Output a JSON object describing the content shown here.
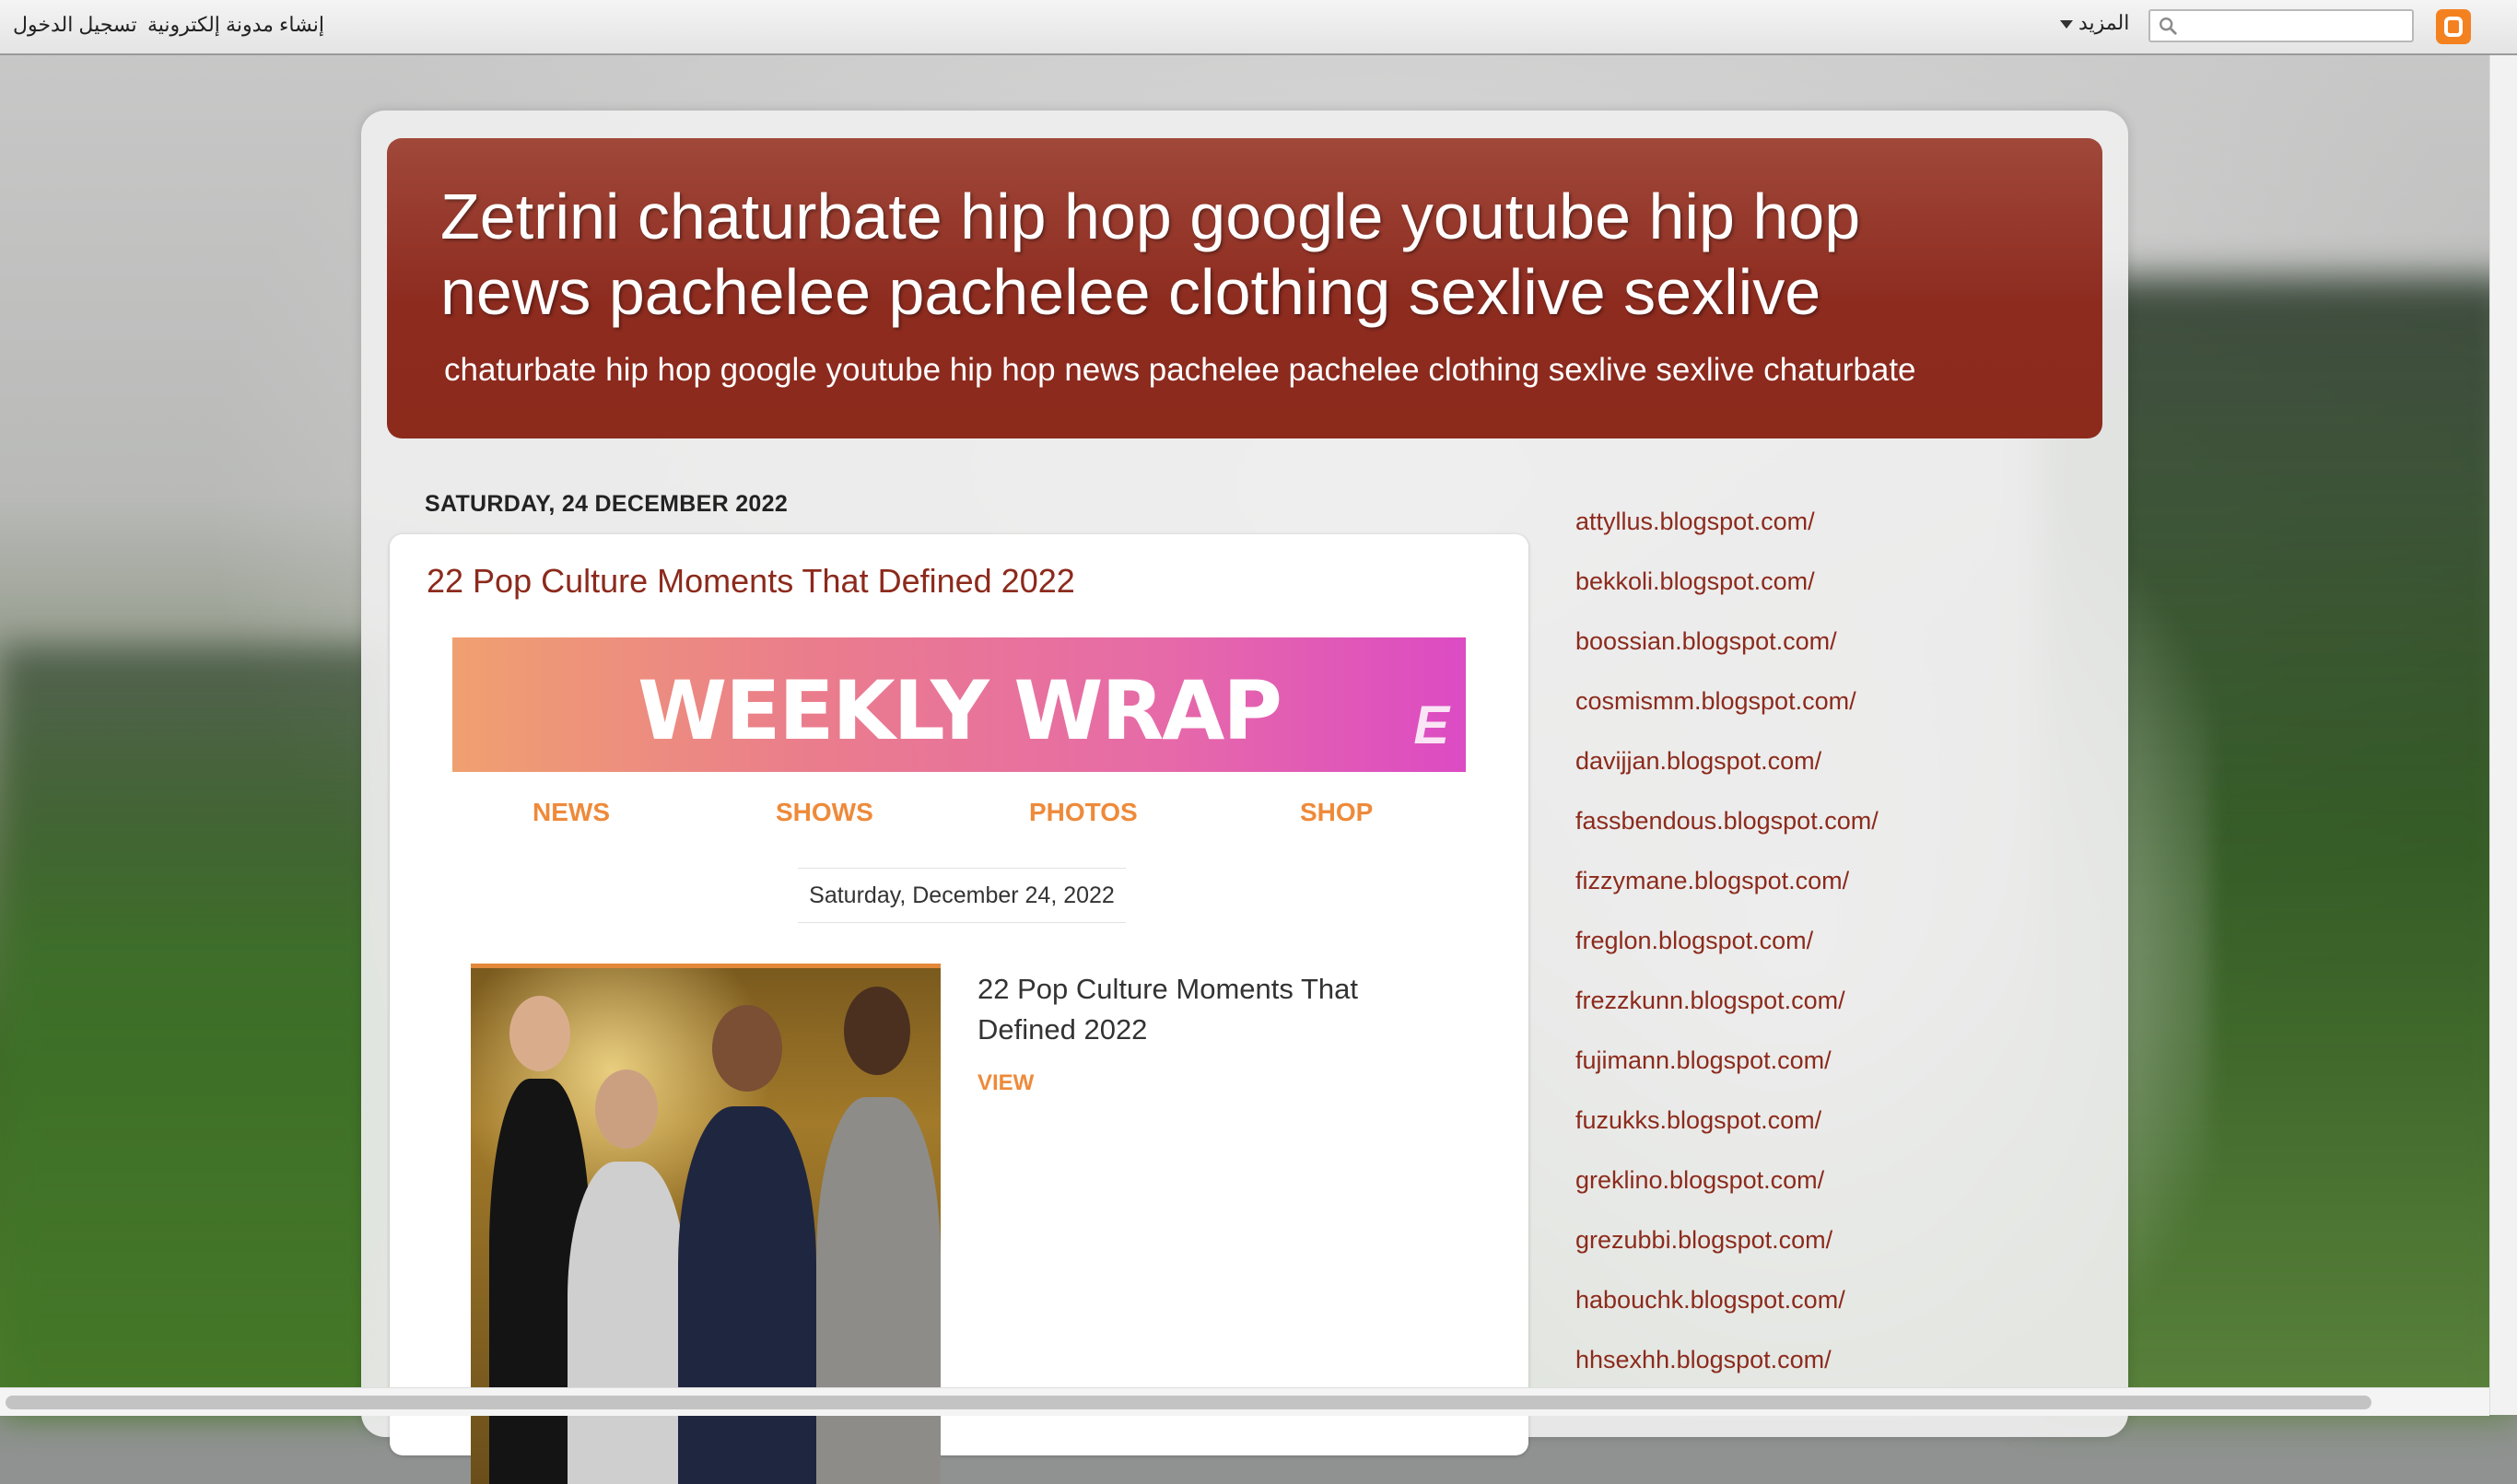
{
  "navbar": {
    "login": "تسجيل الدخول",
    "create_blog": "إنشاء مدونة إلكترونية",
    "more": "المزيد",
    "search_placeholder": ""
  },
  "blog": {
    "title": "Zetrini chaturbate hip hop google youtube hip hop news pachelee pachelee clothing sexlive sexlive",
    "description": "chaturbate hip hop google youtube hip hop news pachelee pachelee clothing sexlive sexlive chaturbate"
  },
  "post": {
    "date_header": "SATURDAY, 24 DECEMBER 2022",
    "title": "22 Pop Culture Moments That Defined 2022",
    "banner_text": "WEEKLY WRAP",
    "banner_logo": "E",
    "tabs": [
      "NEWS",
      "SHOWS",
      "PHOTOS",
      "SHOP"
    ],
    "newsletter_date": "Saturday, December 24, 2022",
    "article_title": "22 Pop Culture Moments That Defined 2022",
    "view_label": "VIEW"
  },
  "sidebar": {
    "links": [
      "attyllus.blogspot.com/",
      "bekkoli.blogspot.com/",
      "boossian.blogspot.com/",
      "cosmismm.blogspot.com/",
      "davijjan.blogspot.com/",
      "fassbendous.blogspot.com/",
      "fizzymane.blogspot.com/",
      "freglon.blogspot.com/",
      "frezzkunn.blogspot.com/",
      "fujimann.blogspot.com/",
      "fuzukks.blogspot.com/",
      "greklino.blogspot.com/",
      "grezubbi.blogspot.com/",
      "habouchk.blogspot.com/",
      "hhsexhh.blogspot.com/"
    ]
  },
  "colors": {
    "header_bg": "#8d2b1f",
    "link": "#8c2a1c",
    "accent_orange": "#ee8a3a",
    "blogger_orange": "#f48120"
  }
}
